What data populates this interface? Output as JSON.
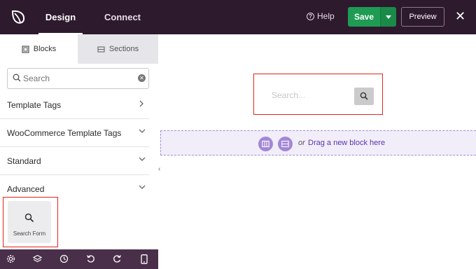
{
  "header": {
    "logo_icon": "leaf-logo-icon",
    "tabs": [
      "Design",
      "Connect"
    ],
    "help_label": "Help",
    "save_label": "Save",
    "preview_label": "Preview",
    "close_icon": "close-icon"
  },
  "sidebar": {
    "tabs": {
      "blocks": "Blocks",
      "sections": "Sections"
    },
    "search": {
      "placeholder": "Search"
    },
    "categories": [
      "Template Tags",
      "WooCommerce Template Tags",
      "Standard",
      "Advanced"
    ],
    "block": {
      "label": "Search Form",
      "icon": "search-icon"
    },
    "bottom_icons": [
      "gear-icon",
      "layers-icon",
      "history-icon",
      "undo-icon",
      "redo-icon",
      "mobile-icon"
    ]
  },
  "canvas": {
    "search_placeholder": "Search...",
    "dropzone_or": "or",
    "dropzone_text": "Drag a new block here"
  },
  "colors": {
    "header_bg": "#2d1a2d",
    "save_green": "#1f9b53",
    "highlight_red": "#e0261c",
    "dropzone_purple": "#a387d6"
  }
}
